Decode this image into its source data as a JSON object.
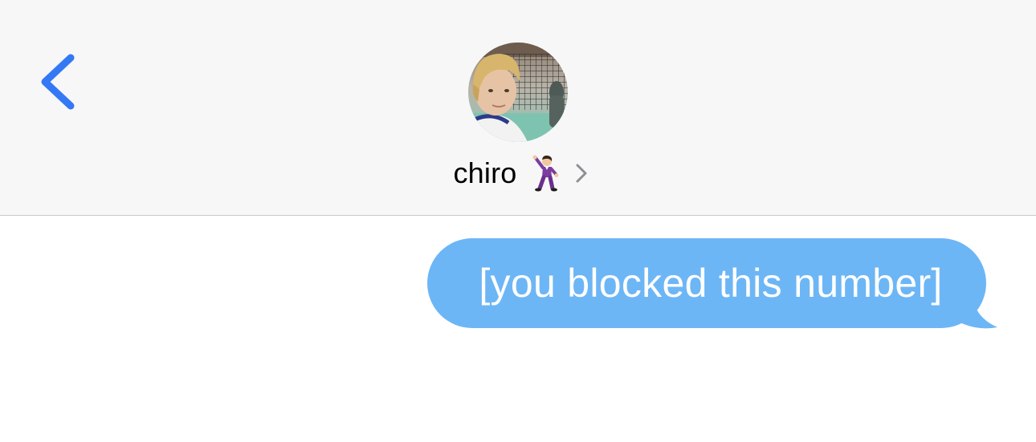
{
  "header": {
    "back_icon": "chevron-left-icon",
    "contact_name": "chiro",
    "contact_emoji": "man-dancing-icon",
    "disclosure_icon": "chevron-right-icon",
    "avatar": "contact-avatar-photo"
  },
  "conversation": {
    "messages": [
      {
        "direction": "outgoing",
        "text": "[you blocked this number]"
      }
    ]
  },
  "colors": {
    "accent": "#3478f6",
    "outgoing_bubble": "#6db6f6",
    "header_bg": "#f7f7f8"
  }
}
